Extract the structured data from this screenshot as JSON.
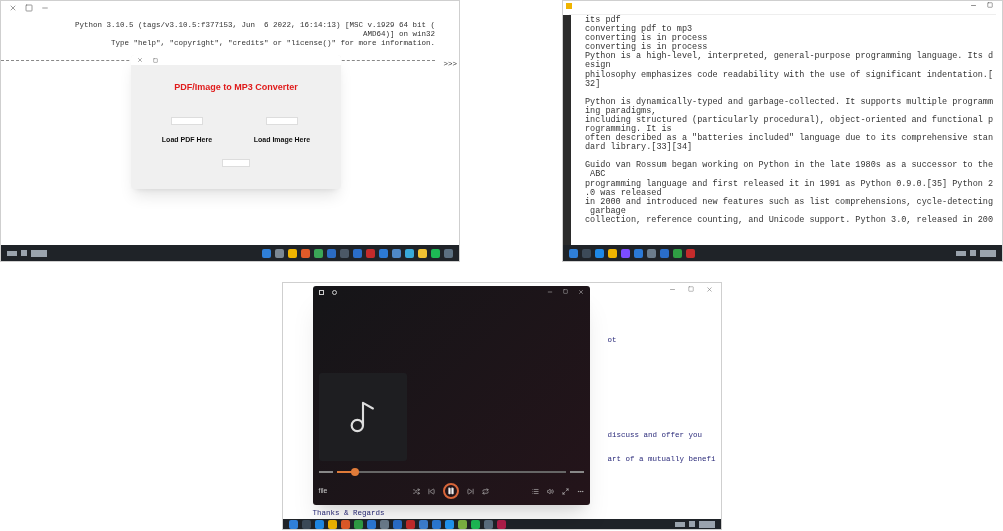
{
  "shell": {
    "lines": [
      "Python 3.10.5 (tags/v3.10.5:f377153, Jun  6 2022, 16:14:13) [MSC v.1929 64 bit (",
      "AMD64)] on win32",
      "Type \"help\", \"copyright\", \"credits\" or \"license()\" for more information."
    ],
    "prompt": ">>>",
    "dialog": {
      "title": "PDF/Image to MP3 Converter",
      "labels": [
        "Load PDF Here",
        "Load Image Here"
      ]
    },
    "taskbar": [
      {
        "color": "#2f7fd8"
      },
      {
        "color": "#7a8793"
      },
      {
        "color": "#f0b400"
      },
      {
        "color": "#e25b29"
      },
      {
        "color": "#3aa657"
      },
      {
        "color": "#2b6cc4"
      },
      {
        "color": "#4b5866"
      },
      {
        "color": "#2a6dc9"
      },
      {
        "color": "#c42b2b"
      },
      {
        "color": "#2c7ad6"
      },
      {
        "color": "#4f88c6"
      },
      {
        "color": "#38a9d9"
      },
      {
        "color": "#f1c232"
      },
      {
        "color": "#1db954"
      },
      {
        "color": "#5b6f80"
      }
    ]
  },
  "editor": {
    "paragraphs": [
      [
        "its pdf",
        "converting pdf to mp3",
        "converting is in process",
        "converting is in process",
        "Python is a high-level, interpreted, general-purpose programming language. Its d",
        "esign",
        "philosophy emphasizes code readability with the use of significant indentation.[",
        "32]"
      ],
      [
        "Python is dynamically-typed and garbage-collected. It supports multiple programm",
        "ing paradigms,",
        "including structured (particularly procedural), object-oriented and functional p",
        "rogramming. It is",
        "often described as a \"batteries included\" language due to its comprehensive stan",
        "dard library.[33][34]"
      ],
      [
        "Guido van Rossum began working on Python in the late 1980s as a successor to the",
        " ABC",
        "programming language and first released it in 1991 as Python 0.9.0.[35] Python 2",
        ".0 was released",
        "in 2000 and introduced new features such as list comprehensions, cycle-detecting",
        " garbage",
        "collection, reference counting, and Unicode support. Python 3.0, released in 200"
      ]
    ],
    "taskbar": [
      {
        "color": "#2f7fd8"
      },
      {
        "color": "#3c4a58"
      },
      {
        "color": "#1e88e5"
      },
      {
        "color": "#f0b400"
      },
      {
        "color": "#7c4dff"
      },
      {
        "color": "#2b79d6"
      },
      {
        "color": "#6b7c8c"
      },
      {
        "color": "#2a6dc9"
      },
      {
        "color": "#2f9e44"
      },
      {
        "color": "#c42b2b"
      }
    ]
  },
  "player": {
    "file": "file",
    "seek": {
      "level": 0.08
    },
    "playing": true,
    "notepad_lines": [
      "ot",
      "discuss and offer you",
      "art of a mutually benefi"
    ],
    "closing": "Thanks & Regards",
    "taskbar": [
      {
        "color": "#2f7fd8"
      },
      {
        "color": "#3c4a58"
      },
      {
        "color": "#1e88e5"
      },
      {
        "color": "#f0b400"
      },
      {
        "color": "#e25b29"
      },
      {
        "color": "#2f9e44"
      },
      {
        "color": "#2b79d6"
      },
      {
        "color": "#6b7c8c"
      },
      {
        "color": "#2a6dc9"
      },
      {
        "color": "#c42b2b"
      },
      {
        "color": "#3d7fd0"
      },
      {
        "color": "#2c7ad6"
      },
      {
        "color": "#2196f3"
      },
      {
        "color": "#7cb342"
      },
      {
        "color": "#1db954"
      },
      {
        "color": "#5b6f80"
      },
      {
        "color": "#b01e4a"
      }
    ]
  }
}
